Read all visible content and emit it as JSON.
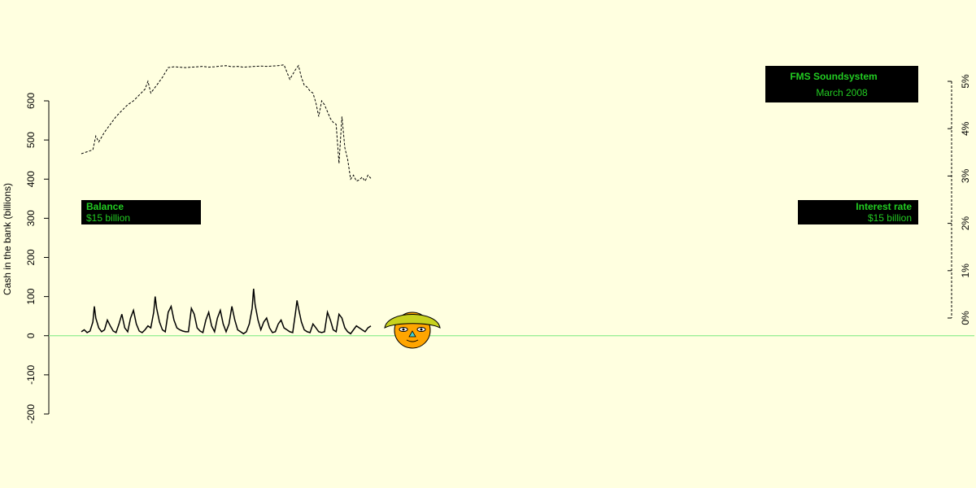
{
  "header_box": {
    "title": "FMS Soundsystem",
    "subtitle": "March 2008"
  },
  "balance_box": {
    "title": "Balance",
    "value": "$15 billion"
  },
  "rate_box": {
    "title": "Interest rate",
    "value": "$15 billion"
  },
  "colors": {
    "background": "#ffffe0",
    "zero_line": "#90ee90",
    "panel_bg": "#000000",
    "panel_text": "#22cc22",
    "face": "#ffa500",
    "hat": "#c8d21e",
    "nose": "#40d0d0"
  },
  "mascot": {
    "icon": "smiling-face-with-hat-icon"
  },
  "chart_data": {
    "type": "line",
    "xlabel": "",
    "ylabel": "Cash in the bank (billions)",
    "x_range": [
      0,
      100
    ],
    "left_axis": {
      "ylim": [
        -200,
        600
      ],
      "ticks": [
        -200,
        -100,
        0,
        100,
        200,
        300,
        400,
        500,
        600
      ]
    },
    "right_axis": {
      "ylim": [
        0,
        5
      ],
      "ticks": [
        "0%",
        "1%",
        "2%",
        "3%",
        "4%",
        "5%"
      ]
    },
    "grid": false,
    "series": [
      {
        "style": "dashed",
        "axis": "left",
        "x": [
          0,
          2,
          4,
          5,
          6,
          8,
          10,
          12,
          14,
          16,
          18,
          20,
          22,
          23,
          24,
          26,
          28,
          30,
          32,
          34,
          36,
          38,
          40,
          42,
          44,
          46,
          48,
          50,
          52,
          54,
          56,
          58,
          60,
          62,
          64,
          66,
          68,
          70,
          72,
          74,
          75,
          76,
          77,
          78,
          79,
          80,
          81,
          82,
          83,
          84,
          86,
          87,
          88,
          89,
          90,
          91,
          92,
          93,
          94,
          95,
          96,
          97,
          98,
          99,
          100
        ],
        "values": [
          465,
          470,
          475,
          510,
          495,
          520,
          540,
          560,
          575,
          590,
          600,
          615,
          630,
          650,
          620,
          640,
          660,
          685,
          687,
          686,
          685,
          686,
          687,
          688,
          686,
          687,
          689,
          690,
          687,
          688,
          686,
          687,
          688,
          689,
          688,
          689,
          690,
          692,
          655,
          680,
          690,
          660,
          640,
          635,
          625,
          620,
          595,
          560,
          600,
          590,
          555,
          545,
          540,
          440,
          560,
          480,
          450,
          400,
          410,
          395,
          398,
          405,
          395,
          410,
          402
        ]
      },
      {
        "style": "solid",
        "axis": "left",
        "x": [
          0,
          1,
          2,
          3,
          4,
          4.5,
          5,
          6,
          7,
          8,
          9,
          10,
          11,
          12,
          13,
          14,
          15,
          16,
          17,
          18,
          19,
          20,
          21,
          22,
          23,
          24,
          25,
          25.5,
          26,
          27,
          28,
          29,
          30,
          31,
          32,
          33,
          34,
          35,
          36,
          37,
          38,
          39,
          40,
          41,
          42,
          43,
          44,
          45,
          46,
          47,
          48,
          49,
          50,
          51,
          52,
          53,
          54,
          55,
          56,
          57,
          58,
          59,
          59.5,
          60,
          61,
          62,
          63,
          64,
          65,
          66,
          67,
          68,
          69,
          70,
          71,
          72,
          73,
          74,
          74.5,
          75,
          76,
          77,
          78,
          79,
          80,
          81,
          82,
          83,
          84,
          85,
          86,
          87,
          88,
          89,
          90,
          91,
          92,
          93,
          94,
          95,
          96,
          97,
          98,
          99,
          100
        ],
        "values": [
          10,
          15,
          8,
          12,
          35,
          75,
          45,
          20,
          10,
          15,
          40,
          25,
          12,
          8,
          30,
          55,
          20,
          10,
          45,
          65,
          30,
          12,
          8,
          15,
          25,
          20,
          60,
          100,
          70,
          35,
          15,
          10,
          60,
          75,
          40,
          20,
          15,
          12,
          10,
          10,
          70,
          55,
          20,
          12,
          8,
          40,
          60,
          25,
          10,
          45,
          65,
          30,
          10,
          30,
          75,
          40,
          15,
          10,
          5,
          10,
          30,
          70,
          120,
          80,
          40,
          15,
          35,
          45,
          20,
          8,
          10,
          30,
          40,
          20,
          15,
          10,
          8,
          60,
          90,
          70,
          35,
          15,
          10,
          8,
          30,
          20,
          10,
          8,
          10,
          60,
          40,
          15,
          10,
          55,
          45,
          20,
          10,
          5,
          15,
          25,
          20,
          15,
          10,
          20,
          25
        ]
      }
    ],
    "reference_line": {
      "y": 0,
      "color": "#90ee90"
    }
  }
}
